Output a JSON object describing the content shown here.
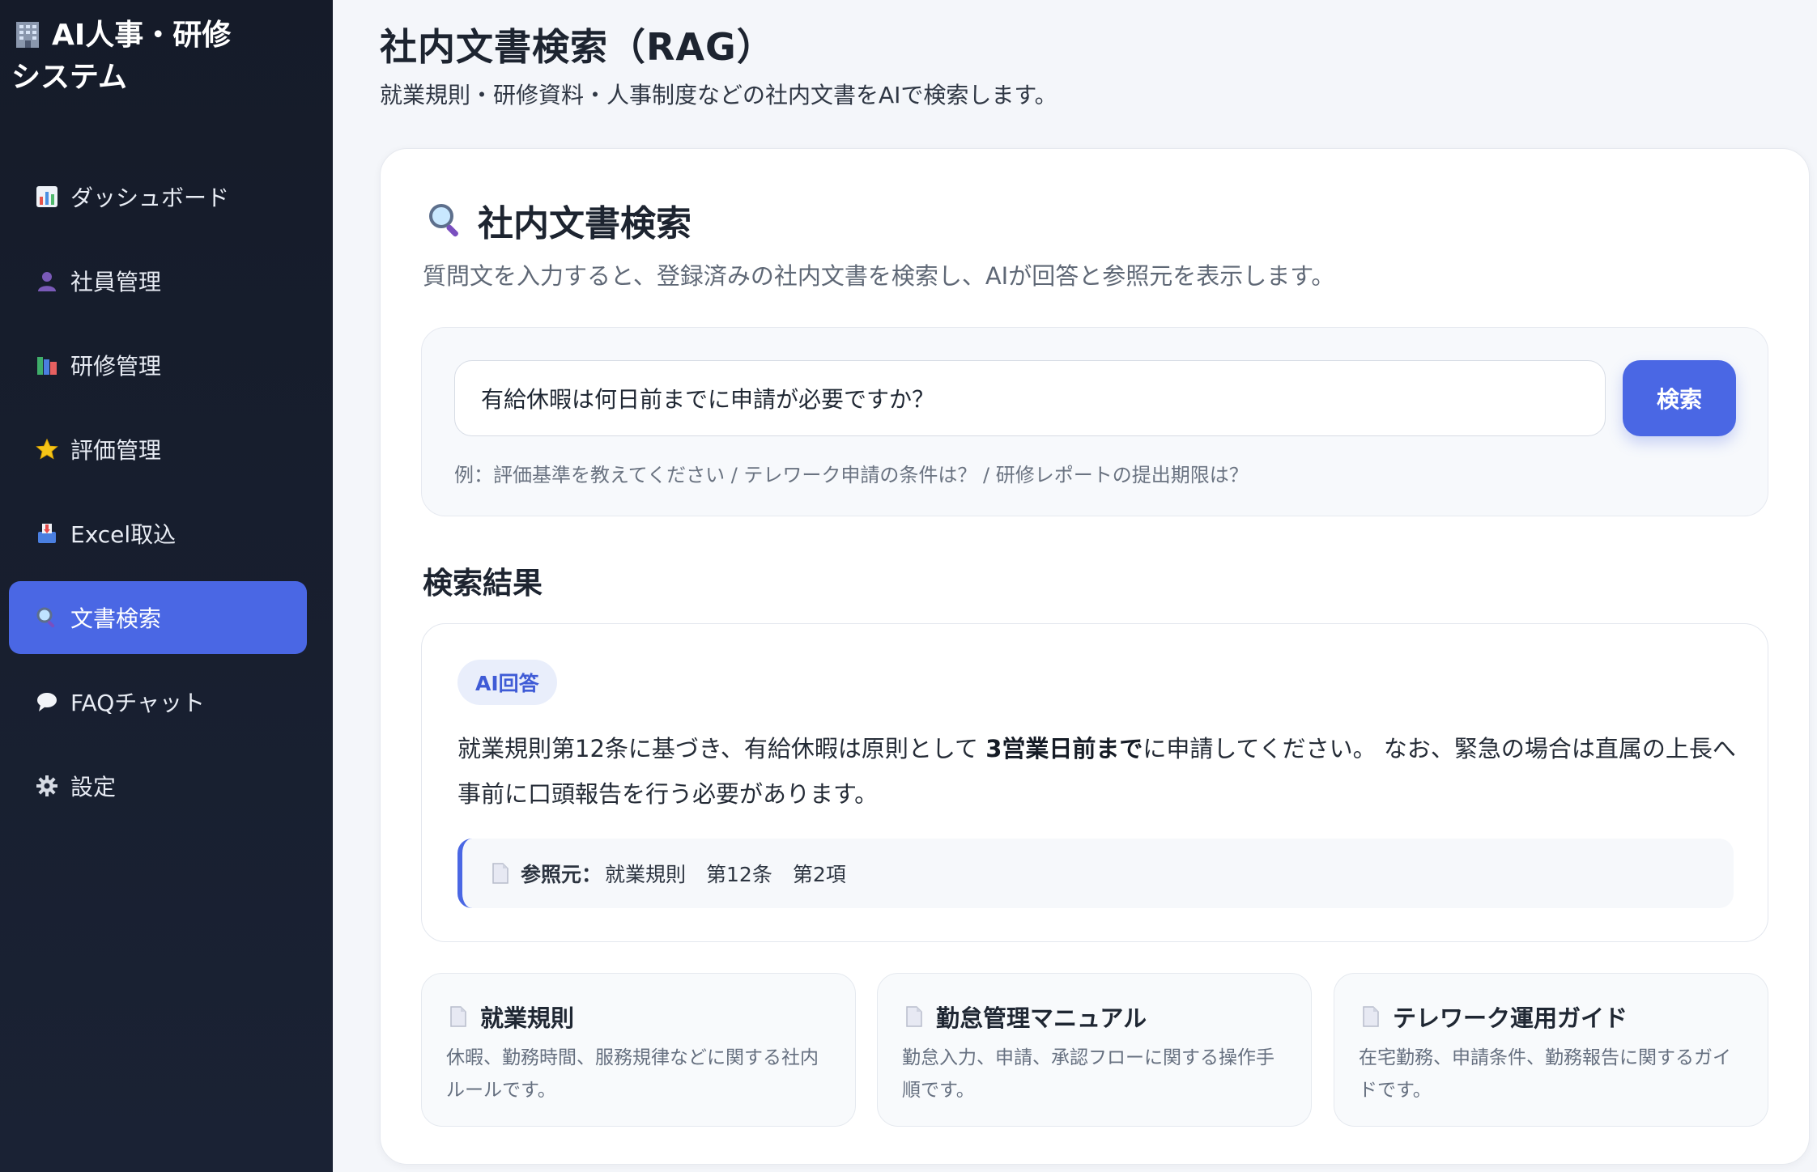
{
  "sidebar": {
    "brand_line1": "AI人事・研修",
    "brand_line2": "システム",
    "brand_icon": "office-building-icon",
    "items": [
      {
        "label": "ダッシュボード",
        "icon": "bar-chart-icon",
        "active": false
      },
      {
        "label": "社員管理",
        "icon": "person-icon",
        "active": false
      },
      {
        "label": "研修管理",
        "icon": "books-icon",
        "active": false
      },
      {
        "label": "評価管理",
        "icon": "star-icon",
        "active": false
      },
      {
        "label": "Excel取込",
        "icon": "inbox-tray-icon",
        "active": false
      },
      {
        "label": "文書検索",
        "icon": "magnifier-icon",
        "active": true
      },
      {
        "label": "FAQチャット",
        "icon": "speech-bubble-icon",
        "active": false
      },
      {
        "label": "設定",
        "icon": "gear-icon",
        "active": false
      }
    ]
  },
  "header": {
    "title": "社内文書検索（RAG）",
    "subtitle": "就業規則・研修資料・人事制度などの社内文書をAIで検索します。"
  },
  "search_card": {
    "title": "社内文書検索",
    "description": "質問文を入力すると、登録済みの社内文書を検索し、AIが回答と参照元を表示します。",
    "input_value": "有給休暇は何日前までに申請が必要ですか？",
    "button_label": "検索",
    "hint": "例：評価基準を教えてください / テレワーク申請の条件は？ / 研修レポートの提出期限は？"
  },
  "results": {
    "title": "検索結果",
    "badge": "AI回答",
    "answer_pre": "就業規則第12条に基づき、有給休暇は原則として ",
    "answer_bold": "3営業日前まで",
    "answer_post": "に申請してください。 なお、緊急の場合は直属の上長へ事前に口頭報告を行う必要があります。",
    "ref_label": "参照元：",
    "ref_value": "就業規則　第12条　第2項"
  },
  "documents": [
    {
      "title": "就業規則",
      "description": "休暇、勤務時間、服務規律などに関する社内ルールです。"
    },
    {
      "title": "勤怠管理マニュアル",
      "description": "勤怠入力、申請、承認フローに関する操作手順です。"
    },
    {
      "title": "テレワーク運用ガイド",
      "description": "在宅勤務、申請条件、勤務報告に関するガイドです。"
    }
  ],
  "colors": {
    "accent": "#4a67e4",
    "sidebar_bg": "#151b29",
    "page_bg": "#f4f6fa",
    "badge_bg": "#e9eefb"
  }
}
